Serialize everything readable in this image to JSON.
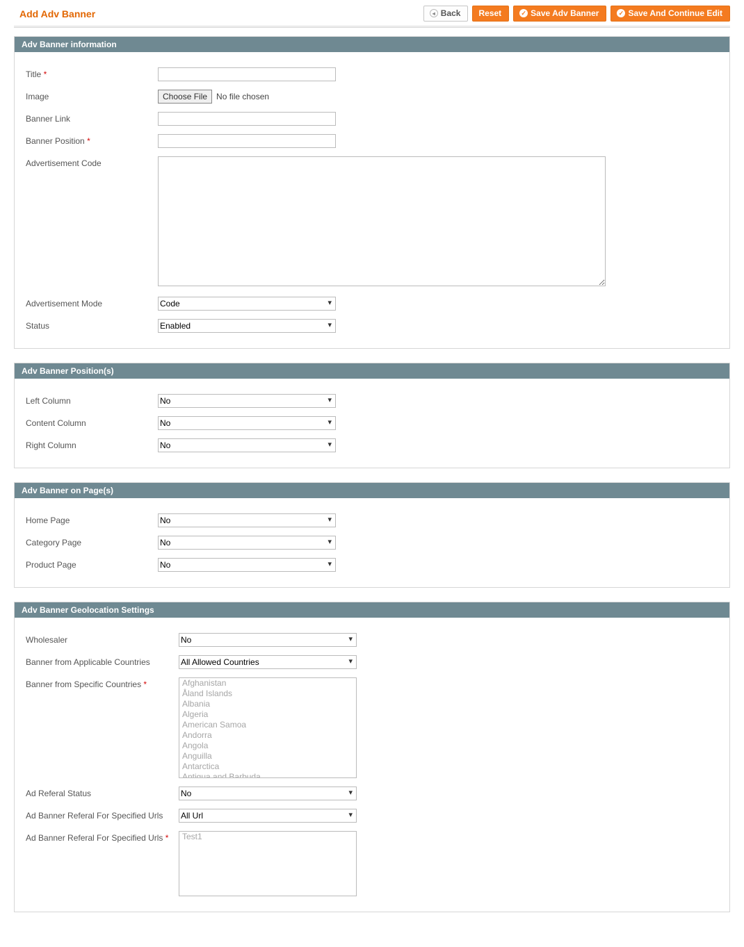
{
  "page_title": "Add Adv Banner",
  "buttons": {
    "back": "Back",
    "reset": "Reset",
    "save": "Save Adv Banner",
    "save_continue": "Save And Continue Edit"
  },
  "section_info": {
    "heading": "Adv Banner information",
    "title_label": "Title",
    "image_label": "Image",
    "choose_file_label": "Choose File",
    "no_file_chosen": "No file chosen",
    "banner_link_label": "Banner Link",
    "banner_position_label": "Banner Position",
    "ad_code_label": "Advertisement Code",
    "ad_mode_label": "Advertisement Mode",
    "ad_mode_value": "Code",
    "status_label": "Status",
    "status_value": "Enabled"
  },
  "section_positions": {
    "heading": "Adv Banner Position(s)",
    "left_label": "Left Column",
    "left_value": "No",
    "content_label": "Content Column",
    "content_value": "No",
    "right_label": "Right Column",
    "right_value": "No"
  },
  "section_pages": {
    "heading": "Adv Banner on Page(s)",
    "home_label": "Home Page",
    "home_value": "No",
    "category_label": "Category Page",
    "category_value": "No",
    "product_label": "Product Page",
    "product_value": "No"
  },
  "section_geo": {
    "heading": "Adv Banner Geolocation Settings",
    "wholesaler_label": "Wholesaler",
    "wholesaler_value": "No",
    "applicable_label": "Banner from Applicable Countries",
    "applicable_value": "All Allowed Countries",
    "specific_label": "Banner from Specific Countries",
    "countries": [
      "Afghanistan",
      "Åland Islands",
      "Albania",
      "Algeria",
      "American Samoa",
      "Andorra",
      "Angola",
      "Anguilla",
      "Antarctica",
      "Antigua and Barbuda"
    ],
    "referal_status_label": "Ad Referal Status",
    "referal_status_value": "No",
    "referal_urls_label": "Ad Banner Referal For Specified Urls",
    "referal_urls_value": "All Url",
    "referal_urls_specific_label": "Ad Banner Referal For Specified Urls",
    "urls_options": [
      "Test1"
    ]
  }
}
